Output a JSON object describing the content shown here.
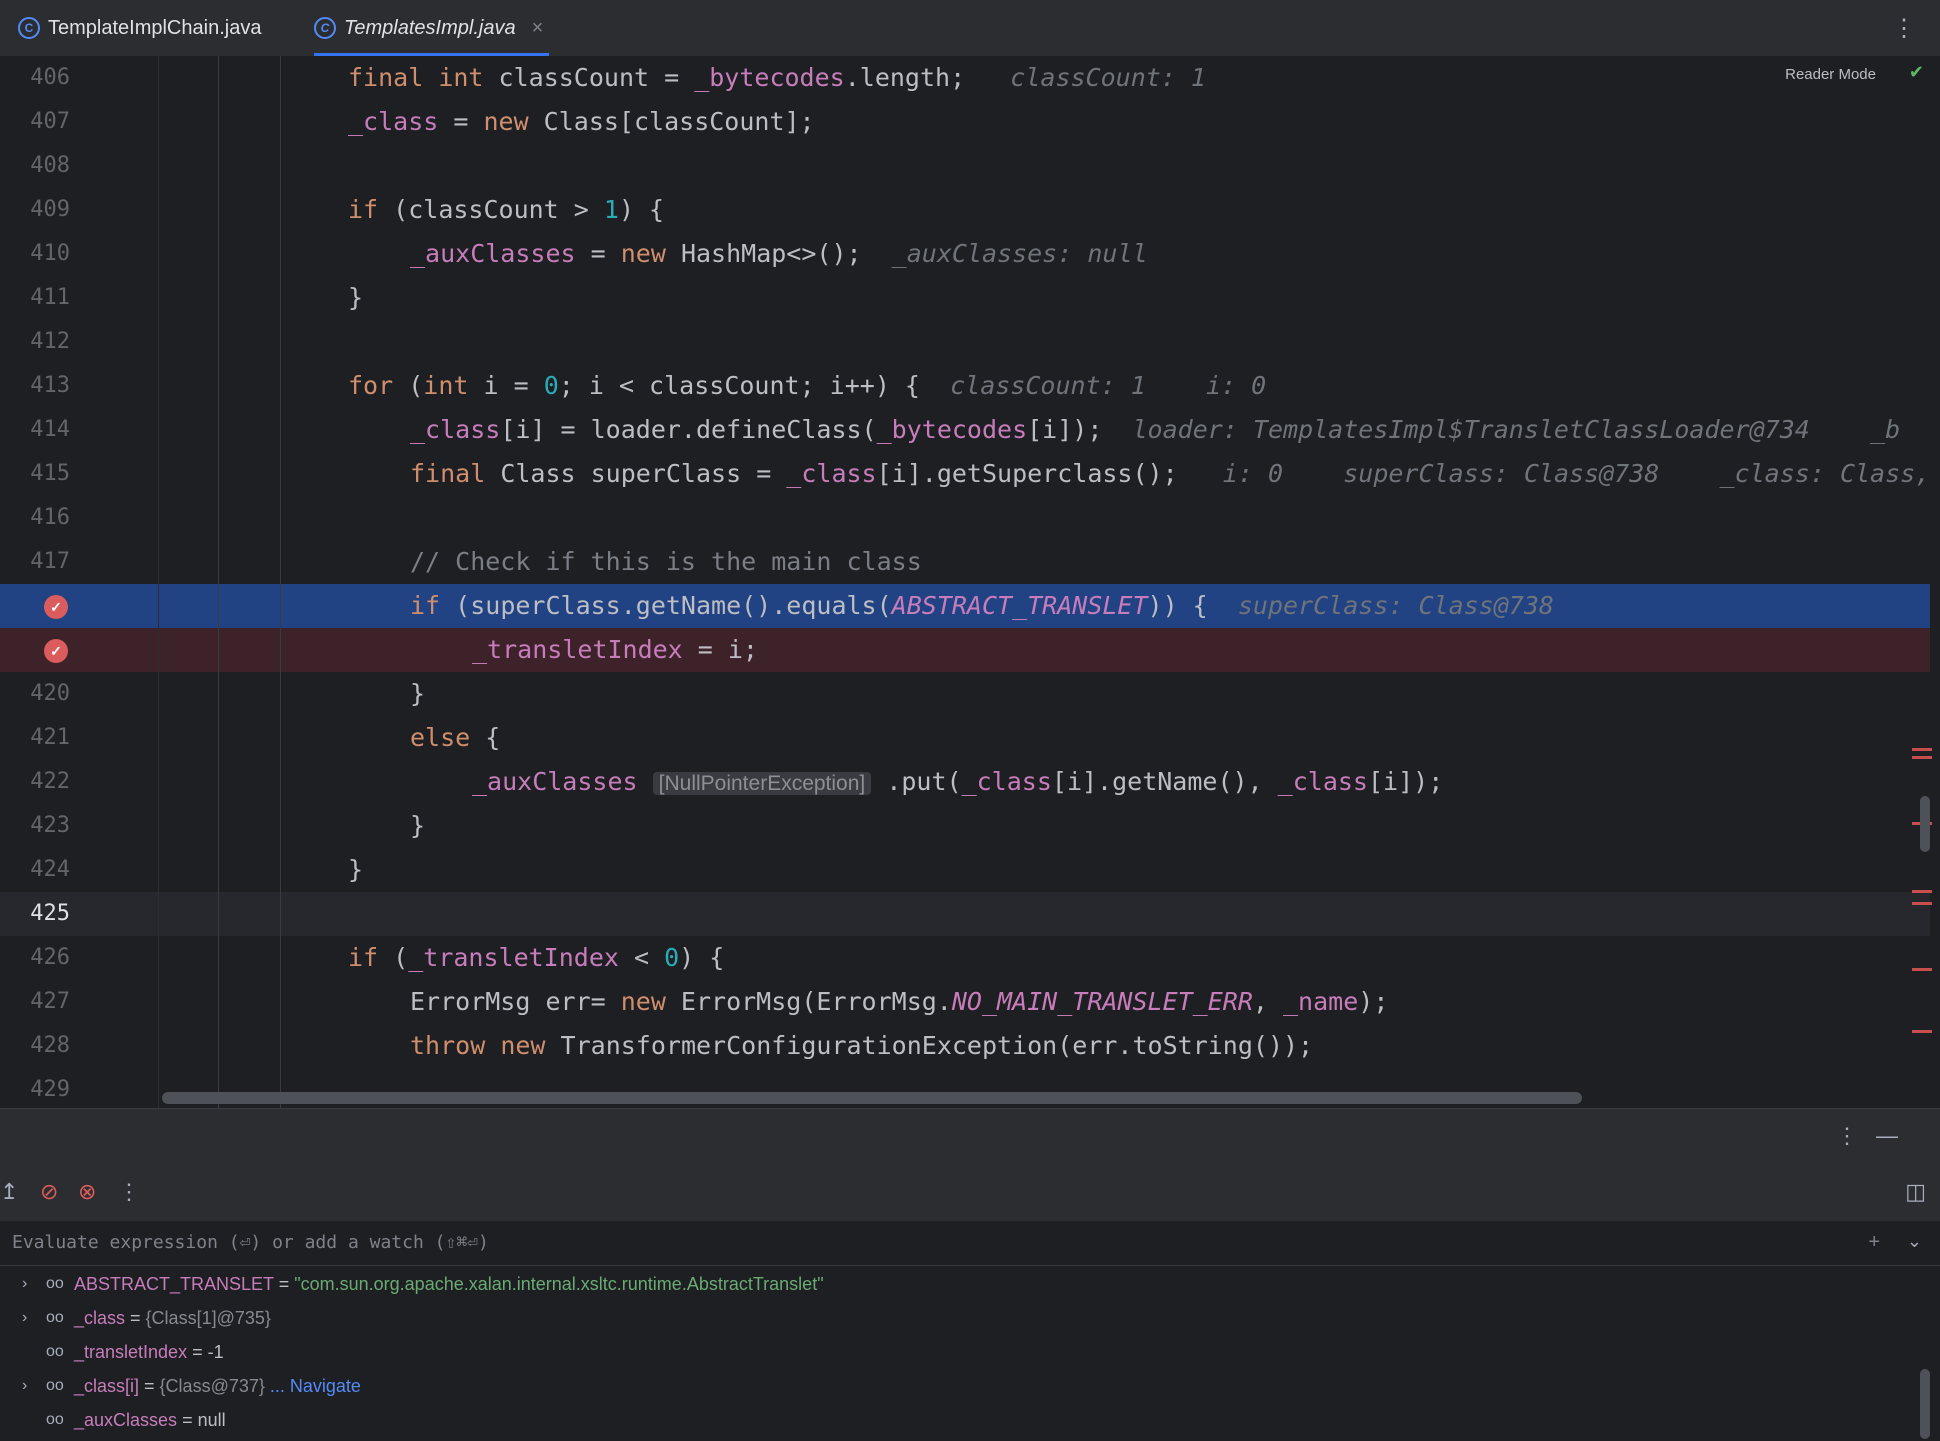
{
  "tabs": [
    {
      "label": "TemplateImplChain.java",
      "icon": "class-icon"
    },
    {
      "label": "TemplatesImpl.java",
      "icon": "class-icon",
      "close": "×"
    }
  ],
  "editor": {
    "reader_mode": "Reader Mode",
    "lines": [
      {
        "n": "406"
      },
      {
        "n": "407"
      },
      {
        "n": "408"
      },
      {
        "n": "409"
      },
      {
        "n": "410"
      },
      {
        "n": "411"
      },
      {
        "n": "412"
      },
      {
        "n": "413"
      },
      {
        "n": "414"
      },
      {
        "n": "415"
      },
      {
        "n": "416"
      },
      {
        "n": "417"
      },
      {
        "n": ""
      },
      {
        "n": ""
      },
      {
        "n": "420"
      },
      {
        "n": "421"
      },
      {
        "n": "422"
      },
      {
        "n": "423"
      },
      {
        "n": "424"
      },
      {
        "n": "425"
      },
      {
        "n": "426"
      },
      {
        "n": "427"
      },
      {
        "n": "428"
      },
      {
        "n": "429"
      }
    ],
    "code": {
      "l406": {
        "kw1": "final",
        "kw2": "int",
        "t1": " classCount = ",
        "f1": "_bytecodes",
        "t2": ".length;",
        "hint": "classCount: 1"
      },
      "l407": {
        "f1": "_class",
        "t1": " = ",
        "kw1": "new",
        "t2": " Class[classCount];"
      },
      "l409": {
        "kw1": "if",
        "t1": " (classCount > ",
        "n1": "1",
        "t2": ") {"
      },
      "l410": {
        "f1": "_auxClasses",
        "t1": " = ",
        "kw1": "new",
        "t2": " HashMap<>();",
        "hint": "_auxClasses: null"
      },
      "l411": {
        "t1": "}"
      },
      "l413": {
        "kw1": "for",
        "t1": " (",
        "kw2": "int",
        "t2": " i = ",
        "n1": "0",
        "t3": "; i < classCount; i++) {",
        "hint1": "classCount: 1",
        "hint2": "i: 0"
      },
      "l414": {
        "f1": "_class",
        "t1": "[i] = loader.defineClass(",
        "f2": "_bytecodes",
        "t2": "[i]);",
        "hint1": "loader: TemplatesImpl$TransletClassLoader@734",
        "hint2": "_b"
      },
      "l415": {
        "kw1": "final",
        "t1": " Class superClass = ",
        "f1": "_class",
        "t2": "[i].getSuperclass();",
        "hint1": "i: 0",
        "hint2": "superClass: Class@738",
        "hint3": "_class: Class,"
      },
      "l417": {
        "cmt": "// Check if this is the main class"
      },
      "l418": {
        "kw1": "if",
        "t1": " (superClass.getName().equals(",
        "c1": "ABSTRACT_TRANSLET",
        "t2": ")) {",
        "hint": "superClass: Class@738"
      },
      "l419": {
        "f1": "_transletIndex",
        "t1": " = i;"
      },
      "l420": {
        "t1": "}"
      },
      "l421": {
        "kw1": "else",
        "t1": " {"
      },
      "l422": {
        "f1": "_auxClasses",
        "inlay": "[NullPointerException]",
        "t1": ".put(",
        "f2": "_class",
        "t2": "[i].getName(), ",
        "f3": "_class",
        "t3": "[i]);"
      },
      "l423": {
        "t1": "}"
      },
      "l424": {
        "t1": "}"
      },
      "l426": {
        "kw1": "if",
        "t1": " (",
        "f1": "_transletIndex",
        "t2": " < ",
        "n1": "0",
        "t3": ") {"
      },
      "l427": {
        "t1": "ErrorMsg err= ",
        "kw1": "new",
        "t2": " ErrorMsg(ErrorMsg.",
        "c1": "NO_MAIN_TRANSLET_ERR",
        "t3": ", ",
        "f1": "_name",
        "t4": ");"
      },
      "l428": {
        "kw1": "throw",
        "t0": " ",
        "kw2": "new",
        "t1": " TransformerConfigurationException(err.toString());"
      }
    }
  },
  "debugger": {
    "eval_placeholder": "Evaluate expression (⏎) or add a watch (⇧⌘⏎)",
    "variables": [
      {
        "name": "ABSTRACT_TRANSLET",
        "eq": " = ",
        "value": "\"com.sun.org.apache.xalan.internal.xsltc.runtime.AbstractTranslet\"",
        "kind": "string",
        "expandable": true
      },
      {
        "name": "_class",
        "eq": " = ",
        "value": "{Class[1]@735}",
        "kind": "ref",
        "expandable": true
      },
      {
        "name": "_transletIndex",
        "eq": " = ",
        "value": "-1",
        "kind": "plain",
        "expandable": false
      },
      {
        "name": "_class[i]",
        "eq": " = ",
        "value": "{Class@737}",
        "kind": "ref",
        "expandable": true,
        "nav": " ... Navigate"
      },
      {
        "name": "_auxClasses",
        "eq": " = ",
        "value": "null",
        "kind": "plain",
        "expandable": false
      }
    ]
  },
  "colors": {
    "accent": "#3574f0",
    "breakpoint": "#db5c5c",
    "exec_line": "#214283"
  }
}
